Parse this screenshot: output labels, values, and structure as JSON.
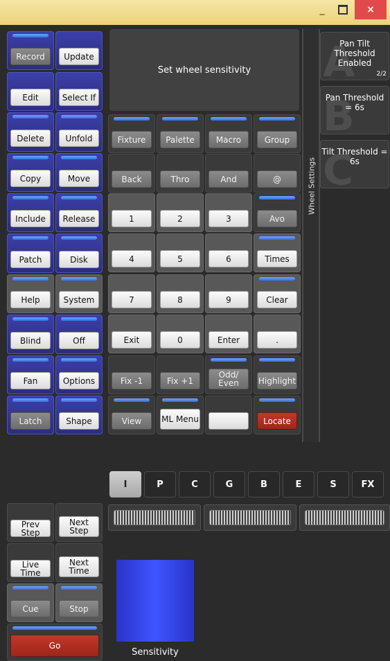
{
  "window": {
    "minimize_glyph": "_",
    "maximize_glyph": "□",
    "close_glyph": "×"
  },
  "prompt": "Set wheel sensitivity",
  "side_label": "Wheel Settings",
  "left_buttons": [
    {
      "label": "Record",
      "style": "grey"
    },
    {
      "label": "Update",
      "style": "white"
    },
    {
      "label": "Edit",
      "style": "white"
    },
    {
      "label": "Select If",
      "style": "white"
    },
    {
      "label": "Delete",
      "style": "white"
    },
    {
      "label": "Unfold",
      "style": "white"
    },
    {
      "label": "Copy",
      "style": "white"
    },
    {
      "label": "Move",
      "style": "white"
    },
    {
      "label": "Include",
      "style": "white"
    },
    {
      "label": "Release",
      "style": "white"
    },
    {
      "label": "Patch",
      "style": "white"
    },
    {
      "label": "Disk",
      "style": "white"
    },
    {
      "label": "Help",
      "style": "white"
    },
    {
      "label": "System",
      "style": "white"
    },
    {
      "label": "Blind",
      "style": "white"
    },
    {
      "label": "Off",
      "style": "white"
    },
    {
      "label": "Fan",
      "style": "white"
    },
    {
      "label": "Options",
      "style": "white"
    },
    {
      "label": "Latch",
      "style": "grey"
    },
    {
      "label": "Shape",
      "style": "white"
    }
  ],
  "keypad": [
    [
      "Fixture",
      "Palette",
      "Macro",
      "Group"
    ],
    [
      "Back",
      "Thro",
      "And",
      "@"
    ],
    [
      "1",
      "2",
      "3",
      "Avo"
    ],
    [
      "4",
      "5",
      "6",
      "Times"
    ],
    [
      "7",
      "8",
      "9",
      "Clear"
    ],
    [
      "Exit",
      "0",
      "Enter",
      "."
    ],
    [
      "Fix -1",
      "Fix +1",
      "Odd/ Even",
      "Highlight"
    ],
    [
      "View",
      "ML Menu",
      "",
      "Locate"
    ]
  ],
  "right_panels": [
    {
      "letter": "A",
      "text": "Pan Tilt Threshold Enabled",
      "page": "2/2"
    },
    {
      "letter": "B",
      "text": "Pan Threshold = 6s"
    },
    {
      "letter": "C",
      "text": "Tilt Threshold = 6s"
    }
  ],
  "tabs": [
    "I",
    "P",
    "C",
    "G",
    "B",
    "E",
    "S",
    "FX"
  ],
  "playback": [
    {
      "label": "Prev Step",
      "style": "white"
    },
    {
      "label": "Next Step",
      "style": "white"
    },
    {
      "label": "Live Time",
      "style": "white"
    },
    {
      "label": "Next Time",
      "style": "white"
    },
    {
      "label": "Cue",
      "style": "grey"
    },
    {
      "label": "Stop",
      "style": "grey"
    }
  ],
  "go_label": "Go",
  "fader_label": "Sensitivity",
  "colors": {
    "accent_blue": "#3f55ff",
    "go_red": "#a8281b",
    "title_bar": "#f2dc8c"
  }
}
